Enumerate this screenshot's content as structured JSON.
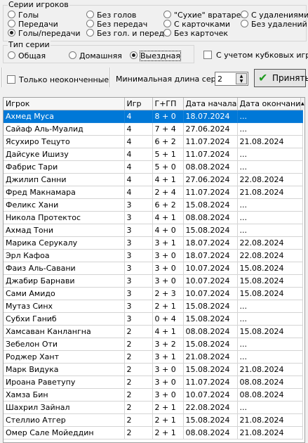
{
  "series_group": {
    "legend": "Серии игроков",
    "options": [
      {
        "label": "Голы",
        "checked": false
      },
      {
        "label": "Без голов",
        "checked": false
      },
      {
        "label": "\"Сухие\" вратарей",
        "checked": false
      },
      {
        "label": "С удалениями",
        "checked": false
      },
      {
        "label": "Передачи",
        "checked": false
      },
      {
        "label": "Без передач",
        "checked": false
      },
      {
        "label": "С карточками",
        "checked": false
      },
      {
        "label": "Без удалений",
        "checked": false
      },
      {
        "label": "Голы/передачи",
        "checked": true
      },
      {
        "label": "Без гол. и перед.",
        "checked": false
      },
      {
        "label": "Без карточек",
        "checked": false
      }
    ]
  },
  "type_group": {
    "legend": "Тип серии",
    "options": [
      {
        "label": "Общая",
        "checked": false
      },
      {
        "label": "Домашняя",
        "checked": false
      },
      {
        "label": "Выездная",
        "checked": true
      }
    ]
  },
  "cup_games_label": "С учетом кубковых игр",
  "unfinished_label": "Только неоконченные",
  "min_length_label": "Минимальная длина серии",
  "min_length_value": "2",
  "apply_label": "Принять",
  "table": {
    "headers": [
      "Игрок",
      "Игр",
      "Г+ГП",
      "Дата начала",
      "Дата окончания"
    ],
    "rows": [
      [
        "Ахмед Муса",
        "4",
        "8 + 0",
        "18.07.2024",
        "..."
      ],
      [
        "Сайаф Аль-Муалид",
        "4",
        "7 + 4",
        "27.06.2024",
        "..."
      ],
      [
        "Ясухиро Тецуто",
        "4",
        "6 + 2",
        "11.07.2024",
        "21.08.2024"
      ],
      [
        "Дайсуке Ишизу",
        "4",
        "5 + 1",
        "11.07.2024",
        "..."
      ],
      [
        "Фабрис Тари",
        "4",
        "5 + 0",
        "08.08.2024",
        "..."
      ],
      [
        "Джилип Санни",
        "4",
        "4 + 1",
        "27.06.2024",
        "22.08.2024"
      ],
      [
        "Фред Макнамара",
        "4",
        "2 + 4",
        "11.07.2024",
        "21.08.2024"
      ],
      [
        "Феликс Хани",
        "3",
        "6 + 2",
        "15.08.2024",
        "..."
      ],
      [
        "Никола Протектос",
        "3",
        "4 + 1",
        "08.08.2024",
        "..."
      ],
      [
        "Ахмад Тони",
        "3",
        "4 + 0",
        "15.08.2024",
        "..."
      ],
      [
        "Марика Серукалу",
        "3",
        "3 + 1",
        "18.07.2024",
        "22.08.2024"
      ],
      [
        "Эрл Кафоа",
        "3",
        "3 + 0",
        "18.07.2024",
        "22.08.2024"
      ],
      [
        "Фаиз Аль-Савани",
        "3",
        "3 + 0",
        "10.07.2024",
        "15.08.2024"
      ],
      [
        "Джабир Барнави",
        "3",
        "3 + 0",
        "10.07.2024",
        "15.08.2024"
      ],
      [
        "Сами Амидо",
        "3",
        "2 + 3",
        "10.07.2024",
        "15.08.2024"
      ],
      [
        "Мутаз Синх",
        "3",
        "2 + 1",
        "15.08.2024",
        "..."
      ],
      [
        "Субхи Ганиб",
        "3",
        "0 + 4",
        "15.08.2024",
        "..."
      ],
      [
        "Хамсаван Канлангна",
        "2",
        "4 + 1",
        "08.08.2024",
        "15.08.2024"
      ],
      [
        "Зебелон Оти",
        "2",
        "3 + 2",
        "15.08.2024",
        "..."
      ],
      [
        "Роджер Хант",
        "2",
        "3 + 1",
        "21.08.2024",
        "..."
      ],
      [
        "Марк Видука",
        "2",
        "3 + 0",
        "15.08.2024",
        "21.08.2024"
      ],
      [
        "Ироана Раветупу",
        "2",
        "3 + 0",
        "11.07.2024",
        "08.08.2024"
      ],
      [
        "Хамза Бин",
        "2",
        "3 + 0",
        "10.07.2024",
        "08.08.2024"
      ],
      [
        "Шахрил Зайнал",
        "2",
        "2 + 1",
        "22.08.2024",
        "..."
      ],
      [
        "Стеллио Атгер",
        "2",
        "2 + 1",
        "15.08.2024",
        "21.08.2024"
      ],
      [
        "Омер Сале Мойеддин",
        "2",
        "2 + 1",
        "08.08.2024",
        "21.08.2024"
      ]
    ]
  },
  "colors": {
    "selection": "#0078d7",
    "apply_icon": "#1e9a1e"
  },
  "icons": {
    "apply": "checkmark-icon",
    "spin": "spin-arrows-icon"
  }
}
